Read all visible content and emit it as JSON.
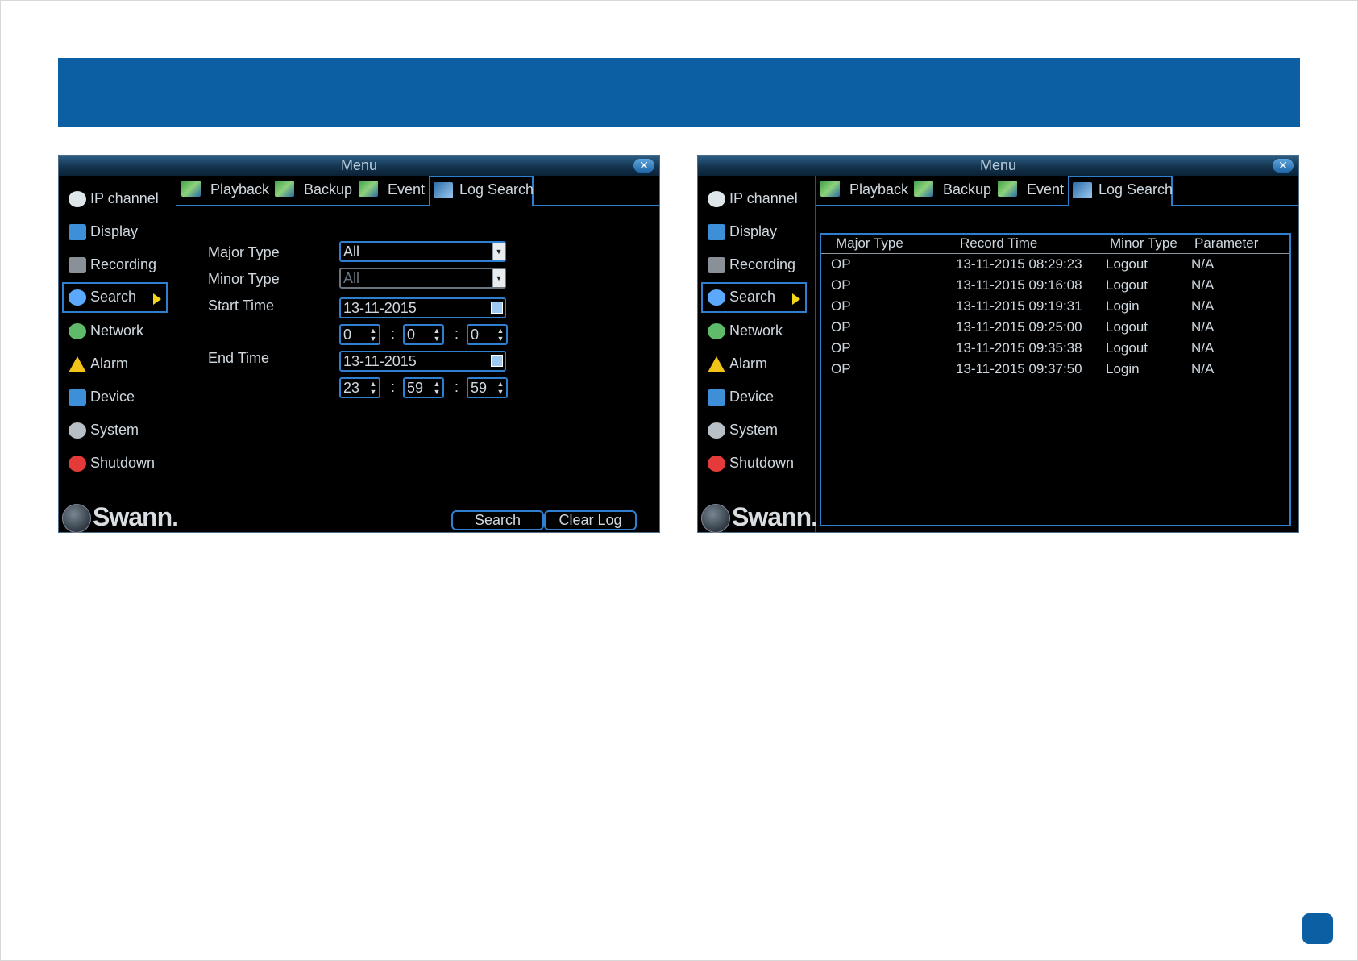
{
  "menu_title": "Menu",
  "close_glyph": "✕",
  "sidebar": {
    "items": [
      {
        "label": "IP channel",
        "icon": "webcam-icon",
        "color": "#dfe6ea"
      },
      {
        "label": "Display",
        "icon": "display-icon",
        "color": "#3d8fd8"
      },
      {
        "label": "Recording",
        "icon": "recording-icon",
        "color": "#8a9097"
      },
      {
        "label": "Search",
        "icon": "search-icon",
        "color": "#5aa9ff"
      },
      {
        "label": "Network",
        "icon": "network-icon",
        "color": "#5fba6a"
      },
      {
        "label": "Alarm",
        "icon": "alarm-icon",
        "color": "#f2c418"
      },
      {
        "label": "Device",
        "icon": "device-icon",
        "color": "#3d8fd8"
      },
      {
        "label": "System",
        "icon": "gear-icon",
        "color": "#b8bfc5"
      },
      {
        "label": "Shutdown",
        "icon": "power-icon",
        "color": "#e43a3a"
      }
    ],
    "active": "Search",
    "logo_text": "Swann."
  },
  "tabs": [
    {
      "label": "Playback"
    },
    {
      "label": "Backup"
    },
    {
      "label": "Event"
    },
    {
      "label": "Log Search"
    }
  ],
  "active_tab": "Log Search",
  "form": {
    "major_type_label": "Major Type",
    "major_type_value": "All",
    "minor_type_label": "Minor Type",
    "minor_type_value": "All",
    "start_time_label": "Start Time",
    "start_date": "13-11-2015",
    "start_hour": "0",
    "start_min": "0",
    "start_sec": "0",
    "end_time_label": "End Time",
    "end_date": "13-11-2015",
    "end_hour": "23",
    "end_min": "59",
    "end_sec": "59",
    "time_separator": ":",
    "search_button": "Search",
    "clear_log_button": "Clear Log"
  },
  "log_table": {
    "columns": [
      "Major Type",
      "Record Time",
      "Minor Type",
      "Parameter"
    ],
    "rows": [
      [
        "OP",
        "13-11-2015 08:29:23",
        "Logout",
        "N/A"
      ],
      [
        "OP",
        "13-11-2015 09:16:08",
        "Logout",
        "N/A"
      ],
      [
        "OP",
        "13-11-2015 09:19:31",
        "Login",
        "N/A"
      ],
      [
        "OP",
        "13-11-2015 09:25:00",
        "Logout",
        "N/A"
      ],
      [
        "OP",
        "13-11-2015 09:35:38",
        "Logout",
        "N/A"
      ],
      [
        "OP",
        "13-11-2015 09:37:50",
        "Login",
        "N/A"
      ]
    ]
  },
  "colors": {
    "banner": "#0d5fa3",
    "accent_border": "#2f7fd0",
    "arrow": "#f2d718"
  }
}
